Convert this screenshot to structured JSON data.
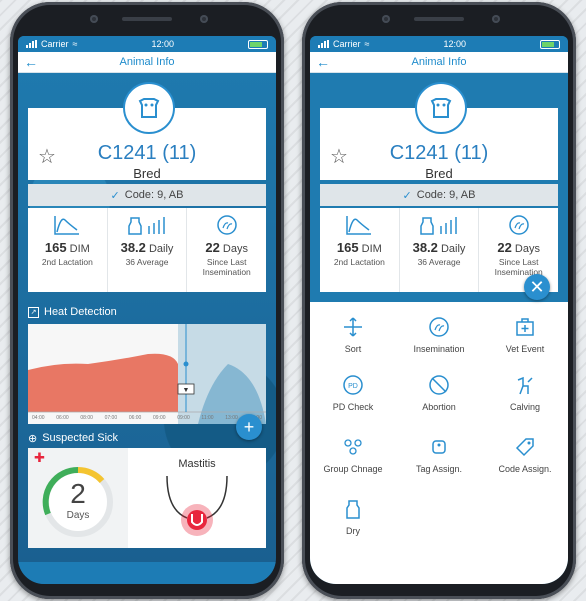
{
  "status": {
    "carrier": "Carrier",
    "time": "12:00"
  },
  "app": {
    "title": "Animal Info"
  },
  "animal": {
    "id": "C1241 (11)",
    "status": "Bred",
    "code": "Code: 9, AB"
  },
  "stats": [
    {
      "value": "165",
      "unit": "DIM",
      "sub": "2nd Lactation"
    },
    {
      "value": "38.2",
      "unit": "Daily",
      "sub": "36 Average"
    },
    {
      "value": "22",
      "unit": "Days",
      "sub": "Since Last Insemination"
    }
  ],
  "heat_detection": {
    "label": "Heat Detection",
    "ticks": [
      "04:00",
      "06:00",
      "08:00",
      "07:00",
      "06:00",
      "09:00",
      "09:00",
      "11:00",
      "13:00",
      "16:00"
    ]
  },
  "suspected_sick": {
    "label": "Suspected Sick",
    "days": "2",
    "days_label": "Days",
    "condition": "Mastitis"
  },
  "actions": [
    {
      "label": "Sort"
    },
    {
      "label": "Insemination"
    },
    {
      "label": "Vet Event"
    },
    {
      "label": "PD Check"
    },
    {
      "label": "Abortion"
    },
    {
      "label": "Calving"
    },
    {
      "label": "Group Chnage"
    },
    {
      "label": "Tag Assign."
    },
    {
      "label": "Code Assign."
    },
    {
      "label": "Dry"
    }
  ],
  "colors": {
    "accent": "#1f8ccc",
    "heat": "#e5604a",
    "sick": "#e8263d",
    "gauge": "#3fae5a"
  }
}
